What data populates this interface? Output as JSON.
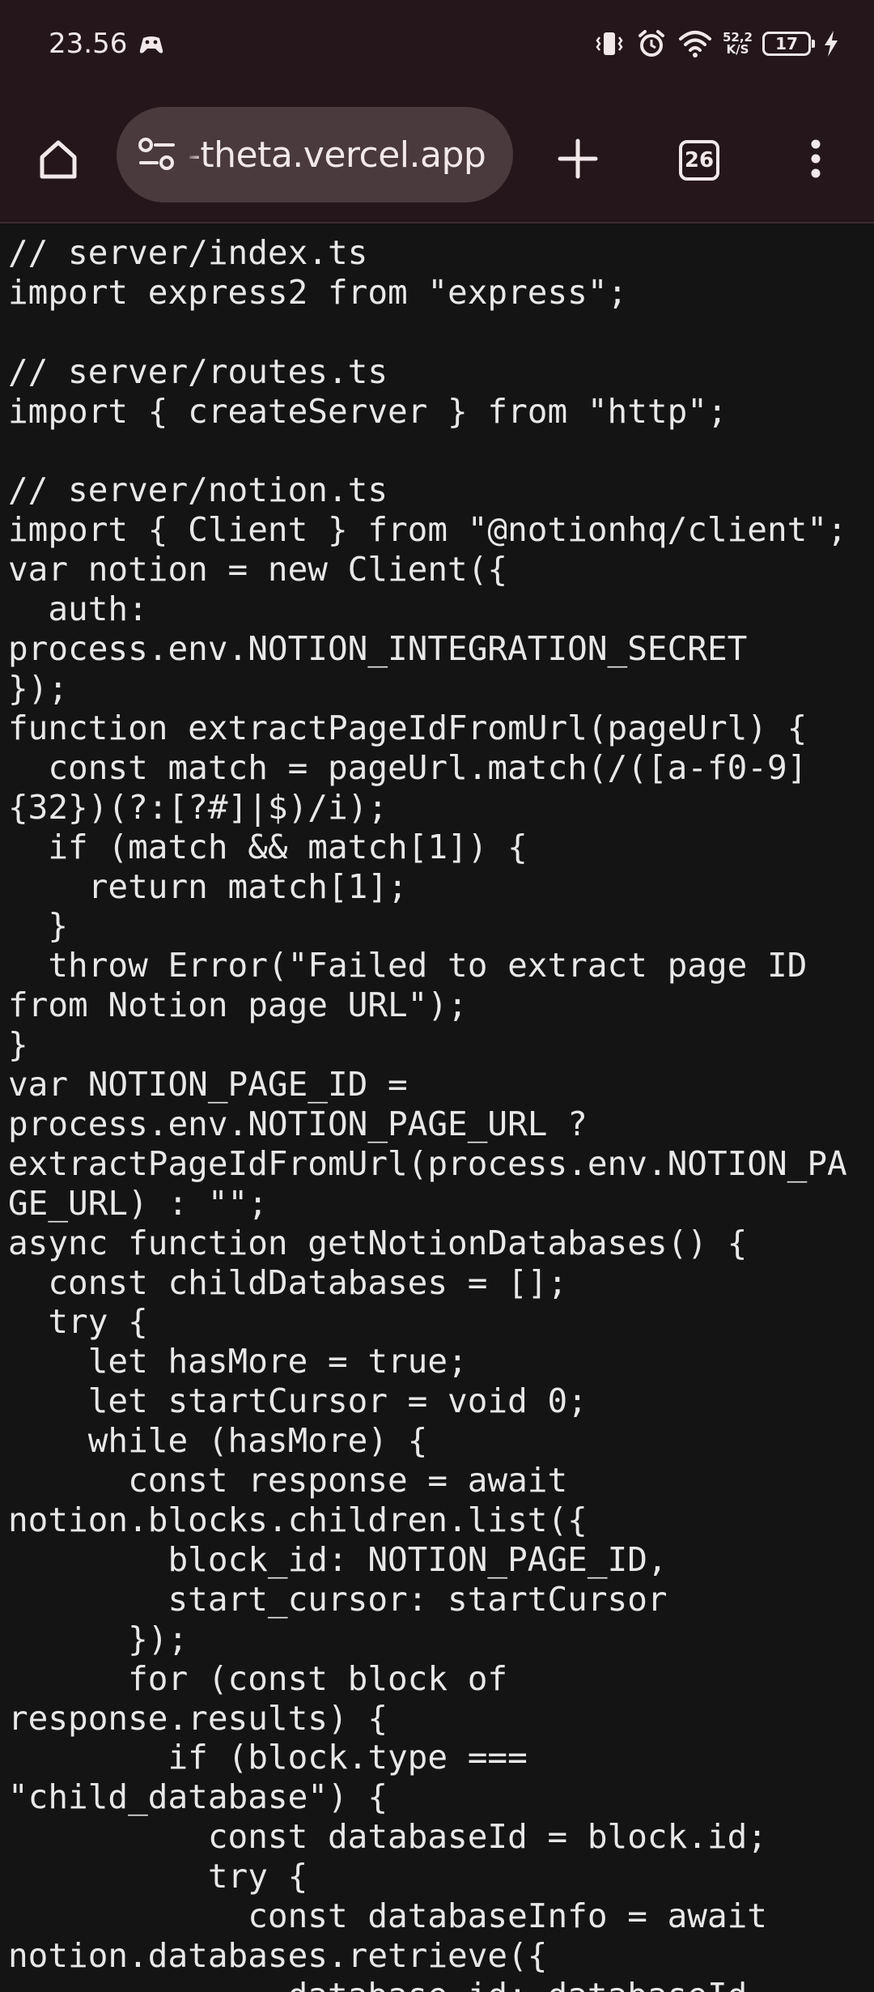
{
  "status_bar": {
    "time": "23.56",
    "net_speed_value": "52,2",
    "net_speed_unit": "K/S",
    "battery_level": "17"
  },
  "toolbar": {
    "url": "-theta.vercel.app",
    "tab_count": "26"
  },
  "page": {
    "code_lines": [
      "// server/index.ts",
      "import express2 from \"express\";",
      "",
      "// server/routes.ts",
      "import { createServer } from \"http\";",
      "",
      "// server/notion.ts",
      "import { Client } from \"@notionhq/client\";",
      "var notion = new Client({",
      "  auth:",
      "process.env.NOTION_INTEGRATION_SECRET",
      "});",
      "function extractPageIdFromUrl(pageUrl) {",
      "  const match = pageUrl.match(/([a-f0-9]",
      "{32})(?:[?#]|$)/i);",
      "  if (match && match[1]) {",
      "    return match[1];",
      "  }",
      "  throw Error(\"Failed to extract page ID",
      "from Notion page URL\");",
      "}",
      "var NOTION_PAGE_ID =",
      "process.env.NOTION_PAGE_URL ?",
      "extractPageIdFromUrl(process.env.NOTION_PA",
      "GE_URL) : \"\";",
      "async function getNotionDatabases() {",
      "  const childDatabases = [];",
      "  try {",
      "    let hasMore = true;",
      "    let startCursor = void 0;",
      "    while (hasMore) {",
      "      const response = await",
      "notion.blocks.children.list({",
      "        block_id: NOTION_PAGE_ID,",
      "        start_cursor: startCursor",
      "      });",
      "      for (const block of",
      "response.results) {",
      "        if (block.type ===",
      "\"child_database\") {",
      "          const databaseId = block.id;",
      "          try {",
      "            const databaseInfo = await",
      "notion.databases.retrieve({",
      "              database_id: databaseId,"
    ]
  }
}
